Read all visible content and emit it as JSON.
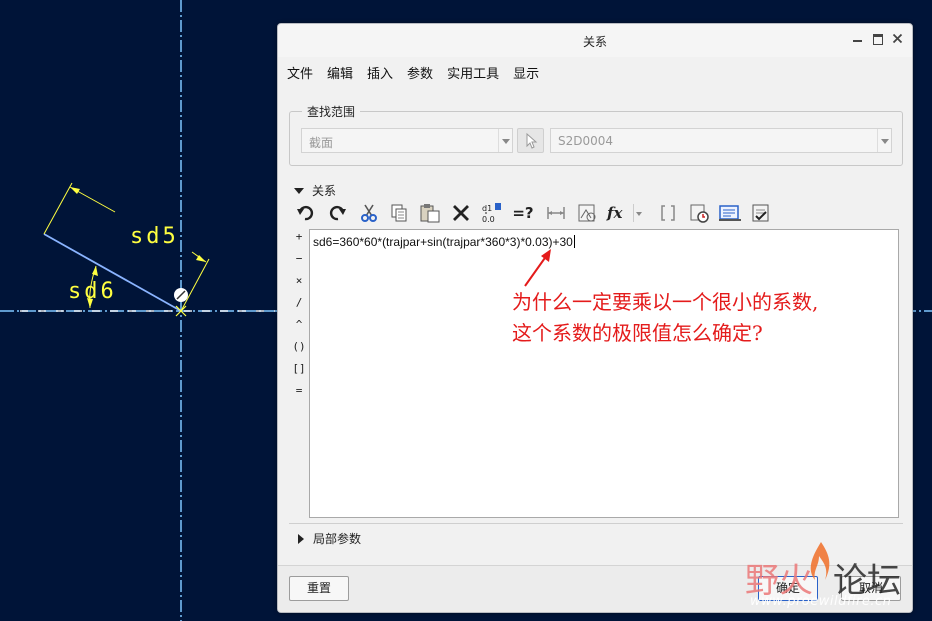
{
  "canvas": {
    "dimensions": [
      "sd5",
      "sd6"
    ],
    "background": "#001438",
    "dim_color": "#ffff40",
    "axis_color": "#7fc7ff"
  },
  "dialog": {
    "title": "关系",
    "menu": [
      "文件",
      "编辑",
      "插入",
      "参数",
      "实用工具",
      "显示"
    ],
    "search_scope": {
      "legend": "查找范围",
      "type_value": "截面",
      "object_value": "S2D0004"
    },
    "relations": {
      "label": "关系",
      "toolbar_icons": [
        "undo-icon",
        "redo-icon",
        "cut-icon",
        "copy-icon",
        "paste-icon",
        "delete-icon",
        "switch-dims-icon",
        "evaluate-icon",
        "display-value-icon",
        "sort-icon",
        "function-icon",
        "parameter-brackets-icon",
        "verify-icon",
        "local-param-icon",
        "check-icon"
      ],
      "eval_label": "=?",
      "function_label": "fx",
      "operators": [
        "+",
        "−",
        "×",
        "/",
        "^",
        "()",
        "[]",
        "="
      ],
      "text": "sd6=360*60*(trajpar+sin(trajpar*360*3)*0.03)+30"
    },
    "local_params_label": "局部参数",
    "buttons": {
      "reset": "重置",
      "ok": "确定",
      "cancel": "取消"
    }
  },
  "annotation": {
    "line1": "为什么一定要乘以一个很小的系数,",
    "line2": "这个系数的极限值怎么确定?",
    "color": "#e41b1b"
  },
  "watermark": {
    "name_left": "野火",
    "name_right": "论坛",
    "url": "www.proewildfire.cn"
  }
}
